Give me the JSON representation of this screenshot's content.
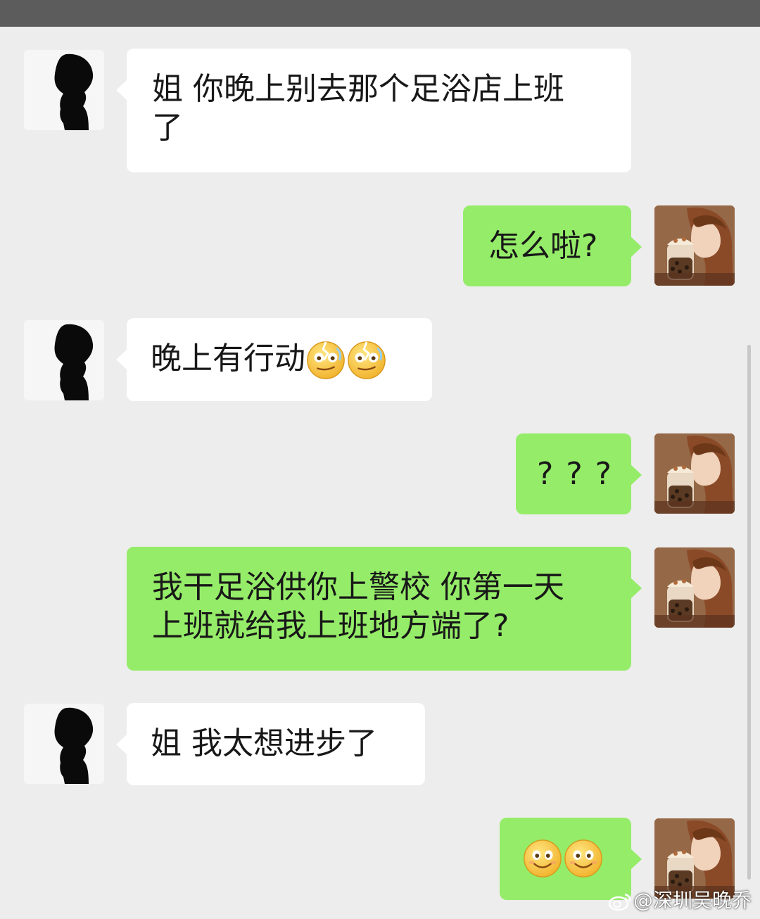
{
  "messages": [
    {
      "side": "left",
      "lines": [
        "姐 你晚上别去那个足浴店上班",
        "了"
      ]
    },
    {
      "side": "right",
      "lines": [
        "怎么啦?"
      ]
    },
    {
      "side": "left",
      "text": "晚上有行动",
      "emoji": [
        "grimace-emoji",
        "grimace-emoji"
      ]
    },
    {
      "side": "right",
      "lines": [
        "? ? ?"
      ]
    },
    {
      "side": "right",
      "lines": [
        "我干足浴供你上警校 你第一天",
        "上班就给我上班地方端了?"
      ]
    },
    {
      "side": "left",
      "lines": [
        "姐 我太想进步了"
      ]
    },
    {
      "side": "right",
      "emoji": [
        "smile-emoji",
        "smile-emoji"
      ]
    }
  ],
  "watermark": {
    "text": "@深圳吴晚乔",
    "icon": "weibo-icon"
  },
  "colors": {
    "self_bubble": "#95ec69",
    "other_bubble": "#ffffff",
    "background": "#ededed"
  }
}
